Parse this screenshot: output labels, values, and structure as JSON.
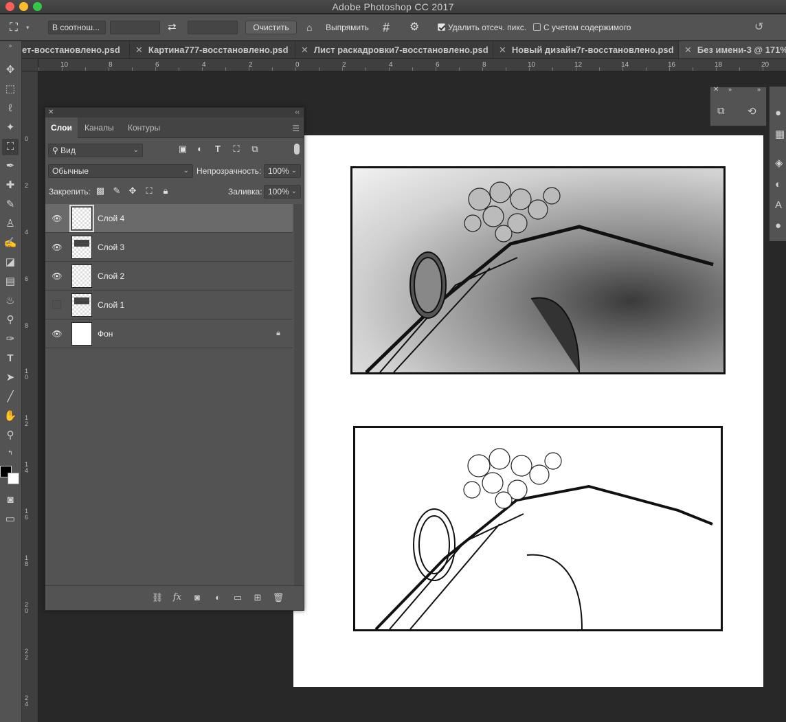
{
  "window": {
    "title": "Adobe Photoshop CC 2017"
  },
  "options_bar": {
    "crop_tool_icon": "crop-icon",
    "ratio_select": "В соотнош...",
    "swap_icon": "swap-arrows-icon",
    "clear_button": "Очистить",
    "straighten_label": "Выпрямить",
    "overlay_icon": "grid-icon",
    "settings_icon": "gear-icon",
    "delete_cropped": "Удалить отсеч. пикс.",
    "delete_cropped_checked": true,
    "content_aware": "С учетом содержимого",
    "content_aware_checked": false
  },
  "tabs": [
    {
      "label": "ет-восстановлено.psd"
    },
    {
      "label": "Картина777-восстановлено.psd"
    },
    {
      "label": "Лист раскадровки7-восстановлено.psd"
    },
    {
      "label": "Новый дизайн7г-восстановлено.psd"
    },
    {
      "label": "Без имени-3 @ 171%"
    }
  ],
  "ruler_h_labels": [
    "10",
    "8",
    "6",
    "4",
    "2",
    "0",
    "2",
    "4",
    "6",
    "8",
    "10",
    "12",
    "14",
    "16",
    "18",
    "20"
  ],
  "ruler_v_labels": [
    "0",
    "2",
    "4",
    "6",
    "8",
    "1 0",
    "1 2",
    "1 4",
    "1 6",
    "1 8",
    "2 0",
    "2 2",
    "2 4"
  ],
  "layers_panel": {
    "tabs": [
      "Слои",
      "Каналы",
      "Контуры"
    ],
    "active_tab": "Слои",
    "filter_label": "Вид",
    "blend_mode": "Обычные",
    "opacity_label": "Непрозрачность:",
    "opacity_value": "100%",
    "lock_label": "Закрепить:",
    "fill_label": "Заливка:",
    "fill_value": "100%",
    "layers": [
      {
        "name": "Слой 4",
        "visible": true,
        "selected": true
      },
      {
        "name": "Слой 3",
        "visible": true,
        "selected": false
      },
      {
        "name": "Слой 2",
        "visible": true,
        "selected": false
      },
      {
        "name": "Слой 1",
        "visible": false,
        "selected": false
      },
      {
        "name": "Фон",
        "visible": true,
        "selected": false,
        "locked": true
      }
    ],
    "footer_fx": "fx"
  },
  "colors": {
    "ui_dark": "#535353",
    "canvas_bg": "#282828",
    "document_bg": "#ffffff"
  }
}
